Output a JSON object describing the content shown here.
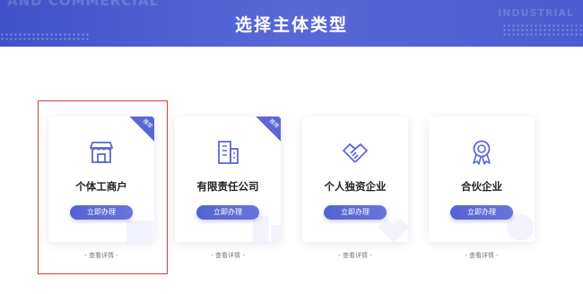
{
  "header": {
    "title": "选择主体类型",
    "deco_left": "AND COMMERCIAL",
    "deco_right": "INDUSTRIAL"
  },
  "cards": [
    {
      "title": "个体工商户",
      "button": "立即办理",
      "details": "- 查看详情 -",
      "icon": "storefront-icon",
      "badge": "推荐",
      "selected": true
    },
    {
      "title": "有限责任公司",
      "button": "立即办理",
      "details": "- 查看详情 -",
      "icon": "office-building-icon",
      "badge": "推荐",
      "selected": false
    },
    {
      "title": "个人独资企业",
      "button": "立即办理",
      "details": "- 查看详情 -",
      "icon": "handshake-icon",
      "selected": false
    },
    {
      "title": "合伙企业",
      "button": "立即办理",
      "details": "- 查看详情 -",
      "icon": "award-medal-icon",
      "selected": false
    }
  ],
  "colors": {
    "banner": "#4a5bcf",
    "button": "#5462d2",
    "icon": "#5b67d4",
    "highlight": "#e13a3a"
  }
}
